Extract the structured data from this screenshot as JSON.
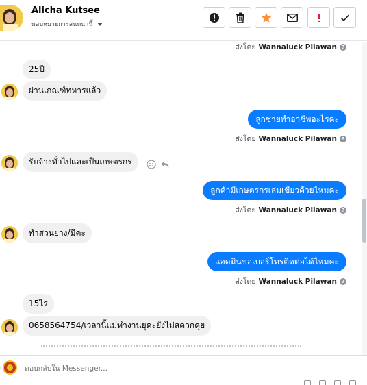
{
  "header": {
    "name": "Alicha Kutsee",
    "assign_label": "มอบหมายการสนทนานี้",
    "toolbar": {
      "spam_icon": "alert-circle-icon",
      "delete_icon": "trash-icon",
      "star_icon": "star-icon",
      "unread_icon": "mail-icon",
      "priority_icon": "exclamation-icon",
      "done_icon": "check-icon"
    }
  },
  "colors": {
    "outgoing_bubble": "#0a7cff",
    "incoming_bubble": "#f0f0f0",
    "star": "#f7923a",
    "priority": "#e41e3f"
  },
  "messages": [
    {
      "dir": "meta",
      "sent_prefix": "ส่งโดย",
      "sender": "Wannaluck Pilawan"
    },
    {
      "dir": "in",
      "text": "25ปี"
    },
    {
      "dir": "in",
      "text": "ผ่านเกณฑ์ทหารแล้ว"
    },
    {
      "dir": "out",
      "text": "ลูกชายทำอาชีพอะไรคะ"
    },
    {
      "dir": "meta",
      "sent_prefix": "ส่งโดย",
      "sender": "Wannaluck Pilawan"
    },
    {
      "dir": "in",
      "text": "รับจ้างทั่วไปและเป็นเกษตรกร"
    },
    {
      "dir": "out",
      "text": "ลูกค้ามีเกษตรกรเล่มเขียวด้วยไหมคะ"
    },
    {
      "dir": "meta",
      "sent_prefix": "ส่งโดย",
      "sender": "Wannaluck Pilawan"
    },
    {
      "dir": "in",
      "text": "ทำสวนยาง/มีคะ"
    },
    {
      "dir": "out",
      "text": "แอดมินขอเบอร์โทรติดต่อได้ไหมคะ"
    },
    {
      "dir": "meta",
      "sent_prefix": "ส่งโดย",
      "sender": "Wannaluck Pilawan"
    },
    {
      "dir": "in",
      "text": "15ไร่"
    },
    {
      "dir": "in",
      "text": "0658564754/เวลานี้แม่ทำงานยุคะยังไม่สดวกคุย"
    }
  ],
  "composer": {
    "placeholder": "ตอบกลับใน Messenger..."
  }
}
